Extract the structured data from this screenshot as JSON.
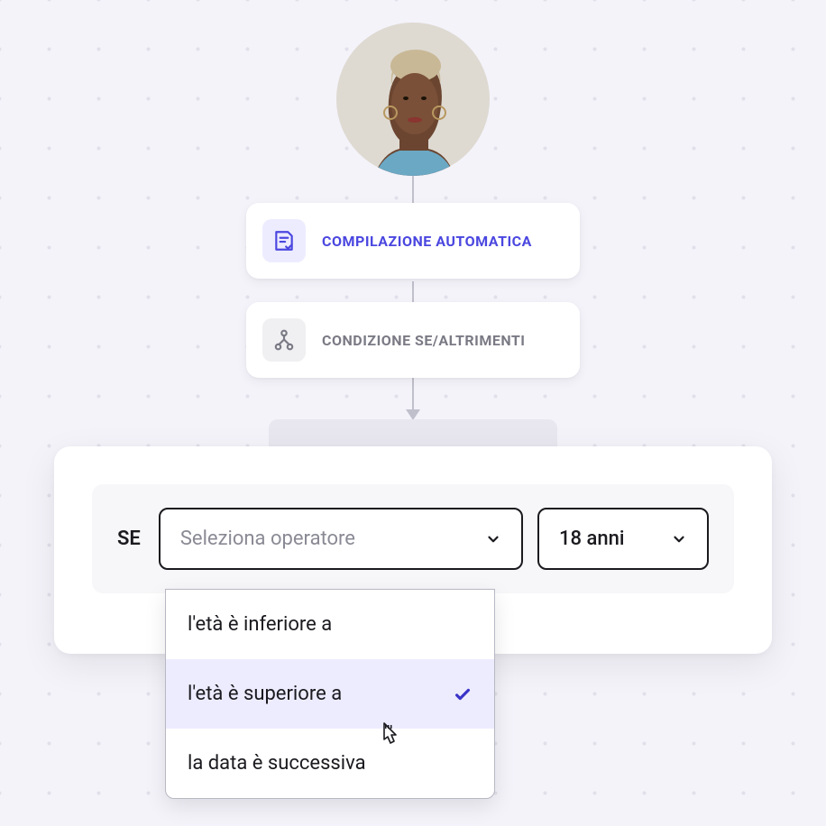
{
  "nodes": {
    "autofill": {
      "label": "COMPILAZIONE AUTOMATICA"
    },
    "condition": {
      "label": "CONDIZIONE SE/ALTRIMENTI"
    }
  },
  "condition_builder": {
    "if_label": "SE",
    "operator_placeholder": "Seleziona operatore",
    "value_selected": "18 anni"
  },
  "dropdown": {
    "options": [
      {
        "label": "l'età è inferiore a",
        "selected": false
      },
      {
        "label": "l'età è superiore a",
        "selected": true
      },
      {
        "label": "la data è successiva",
        "selected": false
      }
    ]
  }
}
